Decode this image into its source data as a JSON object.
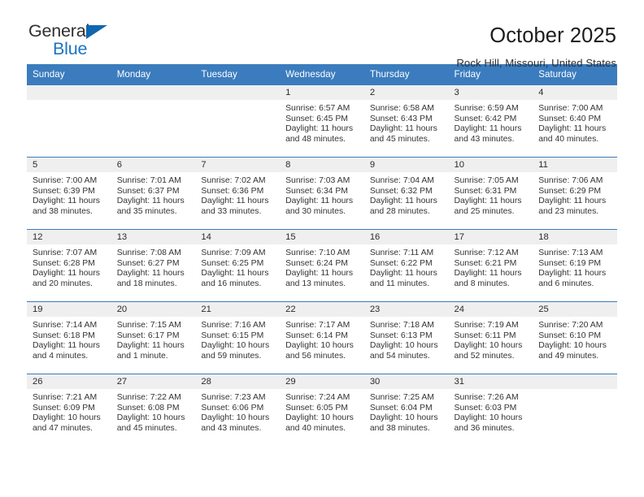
{
  "brand": {
    "name_part1": "General",
    "name_part2": "Blue",
    "triangle_color": "#1066b0",
    "blue_color": "#1b74c4"
  },
  "header": {
    "title": "October 2025",
    "subtitle": "Rock Hill, Missouri, United States"
  },
  "theme": {
    "header_blue": "#3b7cbe",
    "daynum_strip": "#efefef",
    "cell_bg": "#ffffff"
  },
  "calendar": {
    "weekday_headers": [
      "Sunday",
      "Monday",
      "Tuesday",
      "Wednesday",
      "Thursday",
      "Friday",
      "Saturday"
    ],
    "weeks": [
      [
        {
          "day": "",
          "empty": true,
          "sunrise": "",
          "sunset": "",
          "daylight1": "",
          "daylight2": ""
        },
        {
          "day": "",
          "empty": true,
          "sunrise": "",
          "sunset": "",
          "daylight1": "",
          "daylight2": ""
        },
        {
          "day": "",
          "empty": true,
          "sunrise": "",
          "sunset": "",
          "daylight1": "",
          "daylight2": ""
        },
        {
          "day": "1",
          "empty": false,
          "sunrise": "Sunrise: 6:57 AM",
          "sunset": "Sunset: 6:45 PM",
          "daylight1": "Daylight: 11 hours",
          "daylight2": "and 48 minutes."
        },
        {
          "day": "2",
          "empty": false,
          "sunrise": "Sunrise: 6:58 AM",
          "sunset": "Sunset: 6:43 PM",
          "daylight1": "Daylight: 11 hours",
          "daylight2": "and 45 minutes."
        },
        {
          "day": "3",
          "empty": false,
          "sunrise": "Sunrise: 6:59 AM",
          "sunset": "Sunset: 6:42 PM",
          "daylight1": "Daylight: 11 hours",
          "daylight2": "and 43 minutes."
        },
        {
          "day": "4",
          "empty": false,
          "sunrise": "Sunrise: 7:00 AM",
          "sunset": "Sunset: 6:40 PM",
          "daylight1": "Daylight: 11 hours",
          "daylight2": "and 40 minutes."
        }
      ],
      [
        {
          "day": "5",
          "empty": false,
          "sunrise": "Sunrise: 7:00 AM",
          "sunset": "Sunset: 6:39 PM",
          "daylight1": "Daylight: 11 hours",
          "daylight2": "and 38 minutes."
        },
        {
          "day": "6",
          "empty": false,
          "sunrise": "Sunrise: 7:01 AM",
          "sunset": "Sunset: 6:37 PM",
          "daylight1": "Daylight: 11 hours",
          "daylight2": "and 35 minutes."
        },
        {
          "day": "7",
          "empty": false,
          "sunrise": "Sunrise: 7:02 AM",
          "sunset": "Sunset: 6:36 PM",
          "daylight1": "Daylight: 11 hours",
          "daylight2": "and 33 minutes."
        },
        {
          "day": "8",
          "empty": false,
          "sunrise": "Sunrise: 7:03 AM",
          "sunset": "Sunset: 6:34 PM",
          "daylight1": "Daylight: 11 hours",
          "daylight2": "and 30 minutes."
        },
        {
          "day": "9",
          "empty": false,
          "sunrise": "Sunrise: 7:04 AM",
          "sunset": "Sunset: 6:32 PM",
          "daylight1": "Daylight: 11 hours",
          "daylight2": "and 28 minutes."
        },
        {
          "day": "10",
          "empty": false,
          "sunrise": "Sunrise: 7:05 AM",
          "sunset": "Sunset: 6:31 PM",
          "daylight1": "Daylight: 11 hours",
          "daylight2": "and 25 minutes."
        },
        {
          "day": "11",
          "empty": false,
          "sunrise": "Sunrise: 7:06 AM",
          "sunset": "Sunset: 6:29 PM",
          "daylight1": "Daylight: 11 hours",
          "daylight2": "and 23 minutes."
        }
      ],
      [
        {
          "day": "12",
          "empty": false,
          "sunrise": "Sunrise: 7:07 AM",
          "sunset": "Sunset: 6:28 PM",
          "daylight1": "Daylight: 11 hours",
          "daylight2": "and 20 minutes."
        },
        {
          "day": "13",
          "empty": false,
          "sunrise": "Sunrise: 7:08 AM",
          "sunset": "Sunset: 6:27 PM",
          "daylight1": "Daylight: 11 hours",
          "daylight2": "and 18 minutes."
        },
        {
          "day": "14",
          "empty": false,
          "sunrise": "Sunrise: 7:09 AM",
          "sunset": "Sunset: 6:25 PM",
          "daylight1": "Daylight: 11 hours",
          "daylight2": "and 16 minutes."
        },
        {
          "day": "15",
          "empty": false,
          "sunrise": "Sunrise: 7:10 AM",
          "sunset": "Sunset: 6:24 PM",
          "daylight1": "Daylight: 11 hours",
          "daylight2": "and 13 minutes."
        },
        {
          "day": "16",
          "empty": false,
          "sunrise": "Sunrise: 7:11 AM",
          "sunset": "Sunset: 6:22 PM",
          "daylight1": "Daylight: 11 hours",
          "daylight2": "and 11 minutes."
        },
        {
          "day": "17",
          "empty": false,
          "sunrise": "Sunrise: 7:12 AM",
          "sunset": "Sunset: 6:21 PM",
          "daylight1": "Daylight: 11 hours",
          "daylight2": "and 8 minutes."
        },
        {
          "day": "18",
          "empty": false,
          "sunrise": "Sunrise: 7:13 AM",
          "sunset": "Sunset: 6:19 PM",
          "daylight1": "Daylight: 11 hours",
          "daylight2": "and 6 minutes."
        }
      ],
      [
        {
          "day": "19",
          "empty": false,
          "sunrise": "Sunrise: 7:14 AM",
          "sunset": "Sunset: 6:18 PM",
          "daylight1": "Daylight: 11 hours",
          "daylight2": "and 4 minutes."
        },
        {
          "day": "20",
          "empty": false,
          "sunrise": "Sunrise: 7:15 AM",
          "sunset": "Sunset: 6:17 PM",
          "daylight1": "Daylight: 11 hours",
          "daylight2": "and 1 minute."
        },
        {
          "day": "21",
          "empty": false,
          "sunrise": "Sunrise: 7:16 AM",
          "sunset": "Sunset: 6:15 PM",
          "daylight1": "Daylight: 10 hours",
          "daylight2": "and 59 minutes."
        },
        {
          "day": "22",
          "empty": false,
          "sunrise": "Sunrise: 7:17 AM",
          "sunset": "Sunset: 6:14 PM",
          "daylight1": "Daylight: 10 hours",
          "daylight2": "and 56 minutes."
        },
        {
          "day": "23",
          "empty": false,
          "sunrise": "Sunrise: 7:18 AM",
          "sunset": "Sunset: 6:13 PM",
          "daylight1": "Daylight: 10 hours",
          "daylight2": "and 54 minutes."
        },
        {
          "day": "24",
          "empty": false,
          "sunrise": "Sunrise: 7:19 AM",
          "sunset": "Sunset: 6:11 PM",
          "daylight1": "Daylight: 10 hours",
          "daylight2": "and 52 minutes."
        },
        {
          "day": "25",
          "empty": false,
          "sunrise": "Sunrise: 7:20 AM",
          "sunset": "Sunset: 6:10 PM",
          "daylight1": "Daylight: 10 hours",
          "daylight2": "and 49 minutes."
        }
      ],
      [
        {
          "day": "26",
          "empty": false,
          "sunrise": "Sunrise: 7:21 AM",
          "sunset": "Sunset: 6:09 PM",
          "daylight1": "Daylight: 10 hours",
          "daylight2": "and 47 minutes."
        },
        {
          "day": "27",
          "empty": false,
          "sunrise": "Sunrise: 7:22 AM",
          "sunset": "Sunset: 6:08 PM",
          "daylight1": "Daylight: 10 hours",
          "daylight2": "and 45 minutes."
        },
        {
          "day": "28",
          "empty": false,
          "sunrise": "Sunrise: 7:23 AM",
          "sunset": "Sunset: 6:06 PM",
          "daylight1": "Daylight: 10 hours",
          "daylight2": "and 43 minutes."
        },
        {
          "day": "29",
          "empty": false,
          "sunrise": "Sunrise: 7:24 AM",
          "sunset": "Sunset: 6:05 PM",
          "daylight1": "Daylight: 10 hours",
          "daylight2": "and 40 minutes."
        },
        {
          "day": "30",
          "empty": false,
          "sunrise": "Sunrise: 7:25 AM",
          "sunset": "Sunset: 6:04 PM",
          "daylight1": "Daylight: 10 hours",
          "daylight2": "and 38 minutes."
        },
        {
          "day": "31",
          "empty": false,
          "sunrise": "Sunrise: 7:26 AM",
          "sunset": "Sunset: 6:03 PM",
          "daylight1": "Daylight: 10 hours",
          "daylight2": "and 36 minutes."
        },
        {
          "day": "",
          "empty": true,
          "sunrise": "",
          "sunset": "",
          "daylight1": "",
          "daylight2": ""
        }
      ]
    ]
  }
}
